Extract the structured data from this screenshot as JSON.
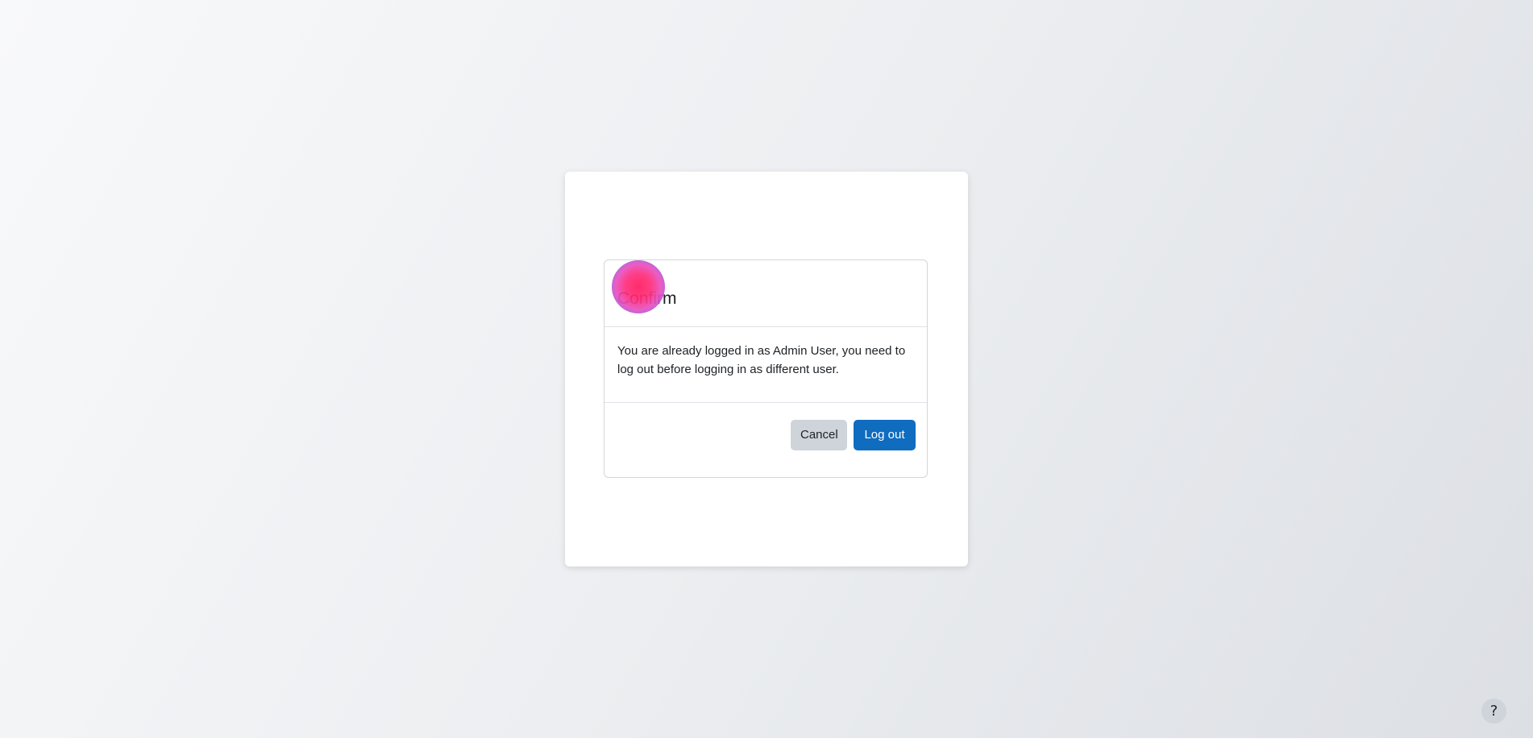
{
  "modal": {
    "title": "Confirm",
    "message": "You are already logged in as Admin User, you need to log out before logging in as different user.",
    "cancel_label": "Cancel",
    "logout_label": "Log out"
  },
  "help": {
    "label": "?",
    "icon": "question-mark-icon"
  },
  "colors": {
    "primary": "#0f6cbf",
    "secondary": "#ced4da",
    "text": "#1d2125",
    "click_marker": "#ff1a5e"
  }
}
